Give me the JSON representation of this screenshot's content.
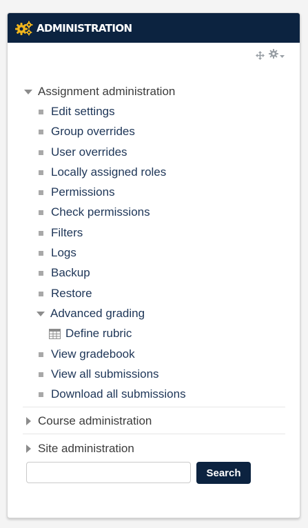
{
  "header": {
    "title": "ADMINISTRATION",
    "icon": "gears-icon",
    "colors": {
      "background": "#0c2340",
      "icon": "#f0b51c",
      "text": "#ffffff"
    }
  },
  "controls": {
    "move_icon": "move-icon",
    "actions_icon": "gear-icon"
  },
  "tree": {
    "assignment_admin": {
      "label": "Assignment administration",
      "expanded": true,
      "items": [
        "Edit settings",
        "Group overrides",
        "User overrides",
        "Locally assigned roles",
        "Permissions",
        "Check permissions",
        "Filters",
        "Logs",
        "Backup",
        "Restore"
      ],
      "advanced_grading": {
        "label": "Advanced grading",
        "expanded": true,
        "child": "Define rubric"
      },
      "items_after": [
        "View gradebook",
        "View all submissions",
        "Download all submissions"
      ]
    },
    "course_admin": {
      "label": "Course administration",
      "expanded": false
    },
    "site_admin": {
      "label": "Site administration",
      "expanded": false
    }
  },
  "search": {
    "value": "",
    "placeholder": "",
    "button_label": "Search"
  }
}
